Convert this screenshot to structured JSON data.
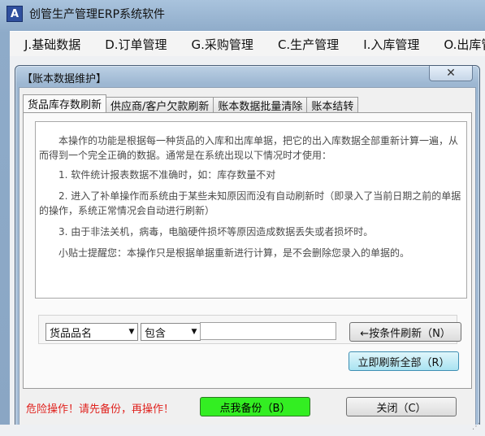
{
  "window": {
    "title": "创管生产管理ERP系统软件",
    "app_icon_glyph": "A"
  },
  "menu": {
    "items": [
      {
        "label": "J.基础数据"
      },
      {
        "label": "D.订单管理"
      },
      {
        "label": "G.采购管理"
      },
      {
        "label": "C.生产管理"
      },
      {
        "label": "I.入库管理"
      },
      {
        "label": "O.出库管理"
      }
    ]
  },
  "dialog": {
    "title": "【账本数据维护】",
    "close_glyph": "✕",
    "tabs": [
      {
        "label": "货品库存数刷新",
        "active": true
      },
      {
        "label": "供应商/客户欠款刷新",
        "active": false
      },
      {
        "label": "账本数据批量清除",
        "active": false
      },
      {
        "label": "账本结转",
        "active": false
      }
    ],
    "info": {
      "p1": "本操作的功能是根据每一种货品的入库和出库单据，把它的出入库数据全部重新计算一遍，从而得到一个完全正确的数据。通常是在系统出现以下情况时才使用：",
      "p2": "1. 软件统计报表数据不准确时，如：库存数量不对",
      "p3": "2. 进入了补单操作而系统由于某些未知原因而没有自动刷新时（即录入了当前日期之前的单据的操作，系统正常情况会自动进行刷新）",
      "p4": "3. 由于非法关机，病毒，电脑硬件损坏等原因造成数据丢失或者损坏时。",
      "p5": "小贴士提醒您：本操作只是根据单据重新进行计算，是不会删除您录入的单据的。"
    },
    "filter": {
      "field_select": "货品品名",
      "operator_select": "包含",
      "value": "",
      "refresh_button": "←按条件刷新（N）"
    },
    "refresh_all_button": "立即刷新全部（R）",
    "warning_text": "危险操作！请先备份，再操作！",
    "backup_button": "点我备份（B）",
    "close_button": "关闭（C）"
  },
  "colors": {
    "warning": "#e0231f",
    "backup_button_bg": "#33ee22",
    "refresh_all_bg": "#a9e3f1"
  }
}
